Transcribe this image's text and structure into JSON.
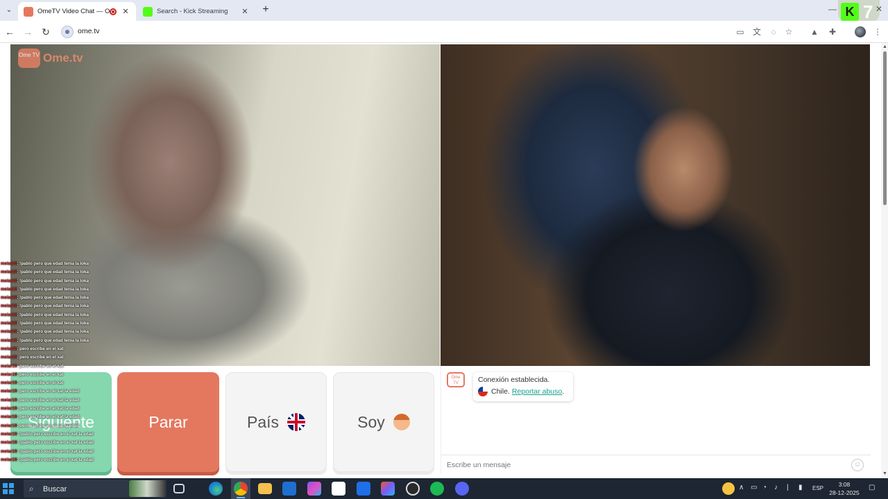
{
  "browser": {
    "tabs": [
      {
        "title": "OmeTV Video Chat — Ome",
        "favicon_color": "#e4785f",
        "active": true
      },
      {
        "title": "Search - Kick Streaming",
        "favicon_color": "#53fc18",
        "active": false
      }
    ],
    "new_tab": "+",
    "url": "ome.tv",
    "kick_badge_number": "7"
  },
  "site": {
    "logo_text": "Ome.tv",
    "logo_badge": "Ome TV"
  },
  "stream_chat": {
    "lines": [
      {
        "user": "meiar19",
        "text": ": !pablo pero que edad tenia la loka"
      },
      {
        "user": "meiar19",
        "text": ": !pablo pero que edad tenia la loka"
      },
      {
        "user": "meiar19",
        "text": ": !pablo pero que edad tenia la loka"
      },
      {
        "user": "meiar19",
        "text": ": !pablo pero que edad tenia la loka"
      },
      {
        "user": "meiar19",
        "text": ": !pablo pero que edad tenia la loka"
      },
      {
        "user": "meiar19",
        "text": ": !pablo pero que edad tenia la loka"
      },
      {
        "user": "meiar19",
        "text": ": !pablo pero que edad tenia la loka"
      },
      {
        "user": "meiar19",
        "text": ": !pablo pero que edad tenia la loka"
      },
      {
        "user": "meiar19",
        "text": ": !pablo pero que edad tenia la loka"
      },
      {
        "user": "meiar19",
        "text": ": !pablo pero que edad tenia la loka"
      },
      {
        "user": "meiar19",
        "text": ": pero escribe en el xat"
      },
      {
        "user": "meiar19",
        "text": ": pero escribe en el xat"
      },
      {
        "user": "meiar19",
        "text": ": pero escribe en el xat"
      },
      {
        "user": "meiar19",
        "text": ": pero escribe en el xat"
      },
      {
        "user": "meiar19",
        "text": ": pero escribe en el xat"
      },
      {
        "user": "meiar19",
        "text": ": pero escribe en el xat la edad"
      },
      {
        "user": "meiar19",
        "text": ": pero escribe en el xat la edad"
      },
      {
        "user": "meiar19",
        "text": ": pero escribe en el xat la edad"
      },
      {
        "user": "meiar19",
        "text": ": pero escribe en el xat la edad"
      },
      {
        "user": "meiar19",
        "text": ": pero escribe en el xat la edad"
      },
      {
        "user": "meiar19",
        "text": ": !pablo pero escribe en el xat la edad"
      },
      {
        "user": "meiar19",
        "text": ": !pablo pero escribe en el xat la edad"
      },
      {
        "user": "meiar19",
        "text": ": !pablo pero escribe en el xat la edad"
      },
      {
        "user": "meiar19",
        "text": ": !pablo pero escribe en el xat la edad"
      }
    ]
  },
  "controls": {
    "next": "Siguiente",
    "stop": "Parar",
    "country": "País",
    "gender": "Soy"
  },
  "chat": {
    "system_icon_text": "Ome TV",
    "status": "Conexión establecida.",
    "country": "Chile.",
    "report_link": "Reportar abuso",
    "report_suffix": ".",
    "input_placeholder": "Escribe un mensaje"
  },
  "taskbar": {
    "search_label": "Buscar",
    "language": "ESP",
    "time": "3:08",
    "date": "28-12-2025"
  },
  "colors": {
    "next": "#86d6ae",
    "stop": "#e4785f",
    "link": "#1a9f8c",
    "taskbar": "#1d2632"
  }
}
